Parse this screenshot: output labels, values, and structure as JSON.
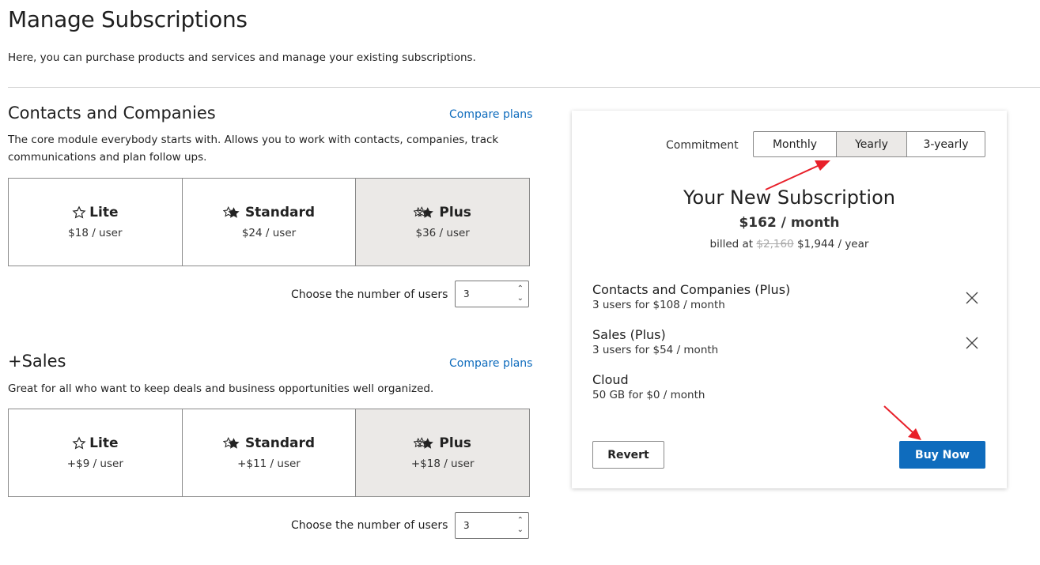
{
  "page": {
    "title": "Manage Subscriptions",
    "intro": "Here, you can purchase products and services and manage your existing subscriptions."
  },
  "sections": [
    {
      "title": "Contacts and Companies",
      "compare_label": "Compare plans",
      "description": "The core module everybody starts with. Allows you to work with contacts, companies, track communications and plan follow ups.",
      "plans": [
        {
          "name": "Lite",
          "price": "$18 / user",
          "icon": "star-outline-icon",
          "selected": false
        },
        {
          "name": "Standard",
          "price": "$24 / user",
          "icon": "two-stars-icon",
          "selected": false
        },
        {
          "name": "Plus",
          "price": "$36 / user",
          "icon": "three-stars-icon",
          "selected": true
        }
      ],
      "users_label": "Choose the number of users",
      "users_value": "3"
    },
    {
      "title": "+Sales",
      "compare_label": "Compare plans",
      "description": "Great for all who want to keep deals and business opportunities well organized.",
      "plans": [
        {
          "name": "Lite",
          "price": "+$9 / user",
          "icon": "star-outline-icon",
          "selected": false
        },
        {
          "name": "Standard",
          "price": "+$11 / user",
          "icon": "two-stars-icon",
          "selected": false
        },
        {
          "name": "Plus",
          "price": "+$18 / user",
          "icon": "three-stars-icon",
          "selected": true
        }
      ],
      "users_label": "Choose the number of users",
      "users_value": "3"
    }
  ],
  "summary": {
    "commitment_label": "Commitment",
    "commitment_options": [
      {
        "label": "Monthly",
        "active": false
      },
      {
        "label": "Yearly",
        "active": true
      },
      {
        "label": "3-yearly",
        "active": false
      }
    ],
    "title": "Your New Subscription",
    "price": "$162 / month",
    "billed_prefix": "billed at",
    "billed_old": "$2,160",
    "billed_new": "$1,944 / year",
    "items": [
      {
        "title": "Contacts and Companies (Plus)",
        "detail": "3 users for $108 / month",
        "removable": true
      },
      {
        "title": "Sales (Plus)",
        "detail": "3 users for $54 / month",
        "removable": true
      },
      {
        "title": "Cloud",
        "detail": "50 GB for $0 / month",
        "removable": false
      }
    ],
    "revert_label": "Revert",
    "buy_label": "Buy Now"
  },
  "colors": {
    "accent": "#0f6cbd",
    "selected_bg": "#ebe9e7",
    "annotation_arrow": "#e8202a"
  }
}
